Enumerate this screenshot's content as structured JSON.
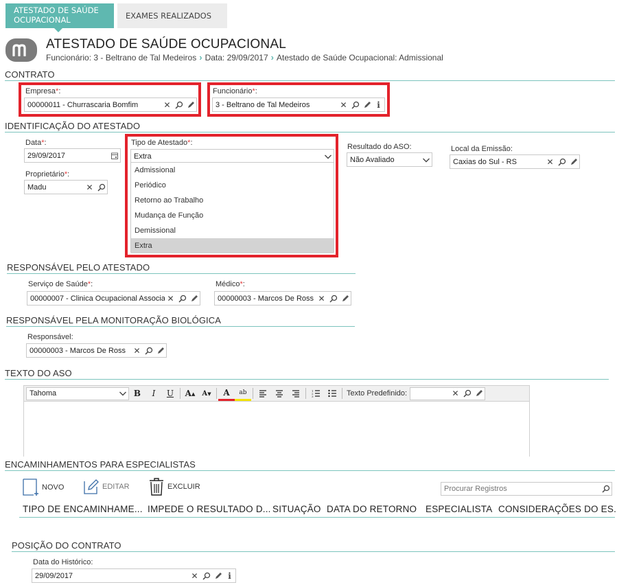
{
  "tabs": [
    {
      "label": "ATESTADO DE SAÚDE OCUPACIONAL"
    },
    {
      "label": "EXAMES REALIZADOS"
    }
  ],
  "header": {
    "title": "ATESTADO DE SAÚDE OCUPACIONAL",
    "breadcrumb": [
      "Funcionário: 3 - Beltrano de Tal Medeiros",
      "Data: 29/09/2017",
      "Atestado de Saúde Ocupacional: Admissional"
    ]
  },
  "contrato": {
    "section": "CONTRATO",
    "empresa_label": "Empresa",
    "empresa_value": "00000011 - Churrascaria Bomfim",
    "funcionario_label": "Funcionário",
    "funcionario_value": "3 - Beltrano de Tal Medeiros"
  },
  "identificacao": {
    "section": "IDENTIFICAÇÃO DO ATESTADO",
    "data_label": "Data",
    "data_value": "29/09/2017",
    "proprietario_label": "Proprietário",
    "proprietario_value": "Madu",
    "tipo_label": "Tipo de Atestado",
    "tipo_value": "Extra",
    "tipo_options": [
      "Admissional",
      "Periódico",
      "Retorno ao Trabalho",
      "Mudança de Função",
      "Demissional",
      "Extra"
    ],
    "resultado_label": "Resultado do ASO:",
    "resultado_value": "Não Avaliado",
    "local_label": "Local da Emissão:",
    "local_value": "Caxias do Sul - RS"
  },
  "responsavel": {
    "section": "RESPONSÁVEL PELO ATESTADO",
    "servico_label": "Serviço de Saúde",
    "servico_value": "00000007 - Clinica Ocupacional Associa",
    "medico_label": "Médico",
    "medico_value": "00000003 - Marcos De Ross"
  },
  "monitoracao": {
    "section": "RESPONSÁVEL PELA MONITORAÇÃO BIOLÓGICA",
    "responsavel_label": "Responsável:",
    "responsavel_value": "00000003 - Marcos De Ross"
  },
  "texto": {
    "section": "TEXTO DO ASO",
    "font_value": "Tahoma",
    "predefinido_label": "Texto Predefinido:"
  },
  "encaminhamentos": {
    "section": "ENCAMINHAMENTOS PARA ESPECIALISTAS",
    "novo": "NOVO",
    "editar": "EDITAR",
    "excluir": "EXCLUIR",
    "search_placeholder": "Procurar Registros",
    "columns": [
      "TIPO DE ENCAMINHAME...",
      "IMPEDE O RESULTADO D...",
      "SITUAÇÃO",
      "DATA DO RETORNO",
      "ESPECIALISTA",
      "CONSIDERAÇÕES DO ES..."
    ]
  },
  "posicao": {
    "section": "POSIÇÃO DO CONTRATO",
    "data_label": "Data do Histórico:",
    "data_value": "29/09/2017"
  },
  "colors": {
    "accent": "#5fb8b0",
    "highlight": "#e3232c"
  }
}
